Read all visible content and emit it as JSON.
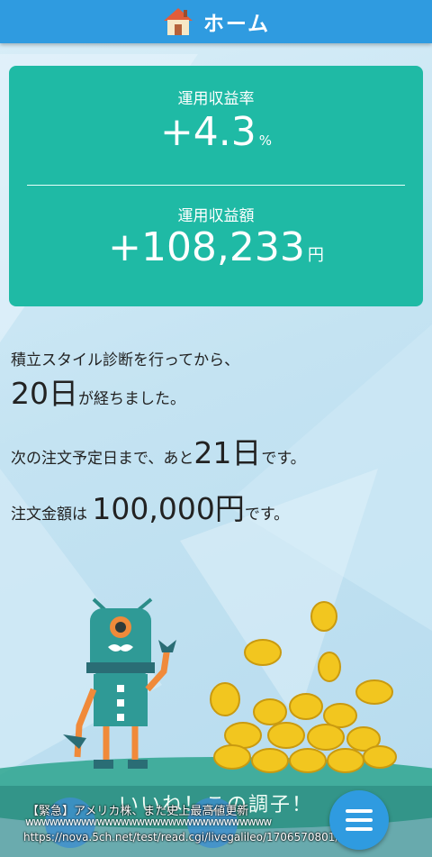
{
  "header": {
    "title": "ホーム",
    "icon": "home-icon"
  },
  "yield_card": {
    "rate_label": "運用収益率",
    "rate_value": "+4.3",
    "rate_unit": "%",
    "amount_label": "運用収益額",
    "amount_value": "+108,233",
    "amount_unit": "円"
  },
  "status": {
    "line1": "積立スタイル診断を行ってから、",
    "days_elapsed": "20日",
    "line2_suffix": "が経ちました。",
    "next_prefix": "次の注文予定日まで、あと",
    "days_remaining": "21日",
    "next_suffix": "です。",
    "order_prefix": "注文金額は",
    "order_amount": "100,000円",
    "order_suffix": "です。"
  },
  "slogan": "いいね！この調子！",
  "news": {
    "headline": "【緊急】アメリカ株、また史上最高値更新",
    "noise": "wwwwwwwwwwwwwwwwwwwwwwwwwwwwwww",
    "url": "https://nova.5ch.net/test/read.cgi/livegalileo/1706570801/"
  },
  "colors": {
    "accent": "#2f9be0",
    "card": "#1fbaa5",
    "coin": "#f2c61f"
  }
}
